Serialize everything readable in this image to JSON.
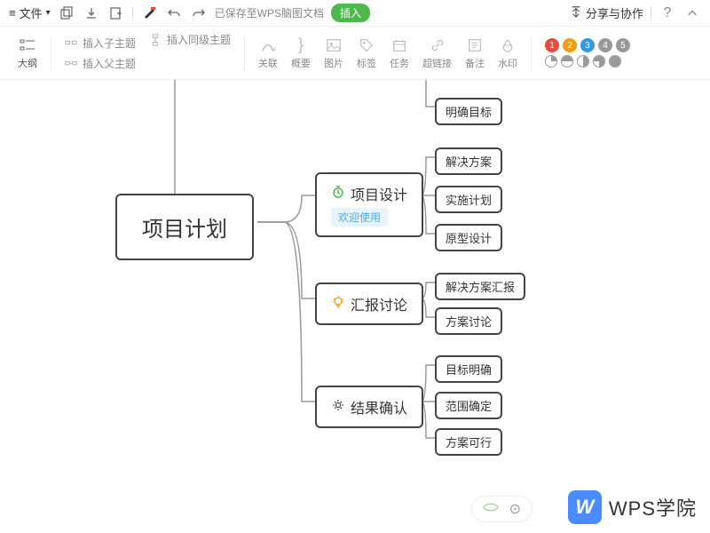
{
  "topbar": {
    "file_label": "文件",
    "save_text": "已保存至WPS脑图文档",
    "insert_label": "插入",
    "share_label": "分享与协作"
  },
  "toolbar": {
    "outline_label": "大纲",
    "insert_child": "插入子主题",
    "insert_sibling": "插入同级主题",
    "insert_parent": "插入父主题",
    "relation": "关联",
    "summary": "概要",
    "image": "图片",
    "tag": "标签",
    "task": "任务",
    "hyperlink": "超链接",
    "note": "备注",
    "watermark": "水印",
    "num1": "1",
    "num2": "2",
    "num3": "3",
    "num4": "4",
    "num5": "5"
  },
  "mindmap": {
    "root": "项目计划",
    "branch1": {
      "leaf1": "明确目标"
    },
    "branch2": {
      "title": "项目设计",
      "welcome": "欢迎使用",
      "leaf1": "解决方案",
      "leaf2": "实施计划",
      "leaf3": "原型设计"
    },
    "branch3": {
      "title": "汇报讨论",
      "leaf1": "解决方案汇报",
      "leaf2": "方案讨论"
    },
    "branch4": {
      "title": "结果确认",
      "leaf1": "目标明确",
      "leaf2": "范围确定",
      "leaf3": "方案可行"
    }
  },
  "footer": {
    "wps_text": "WPS学院"
  }
}
